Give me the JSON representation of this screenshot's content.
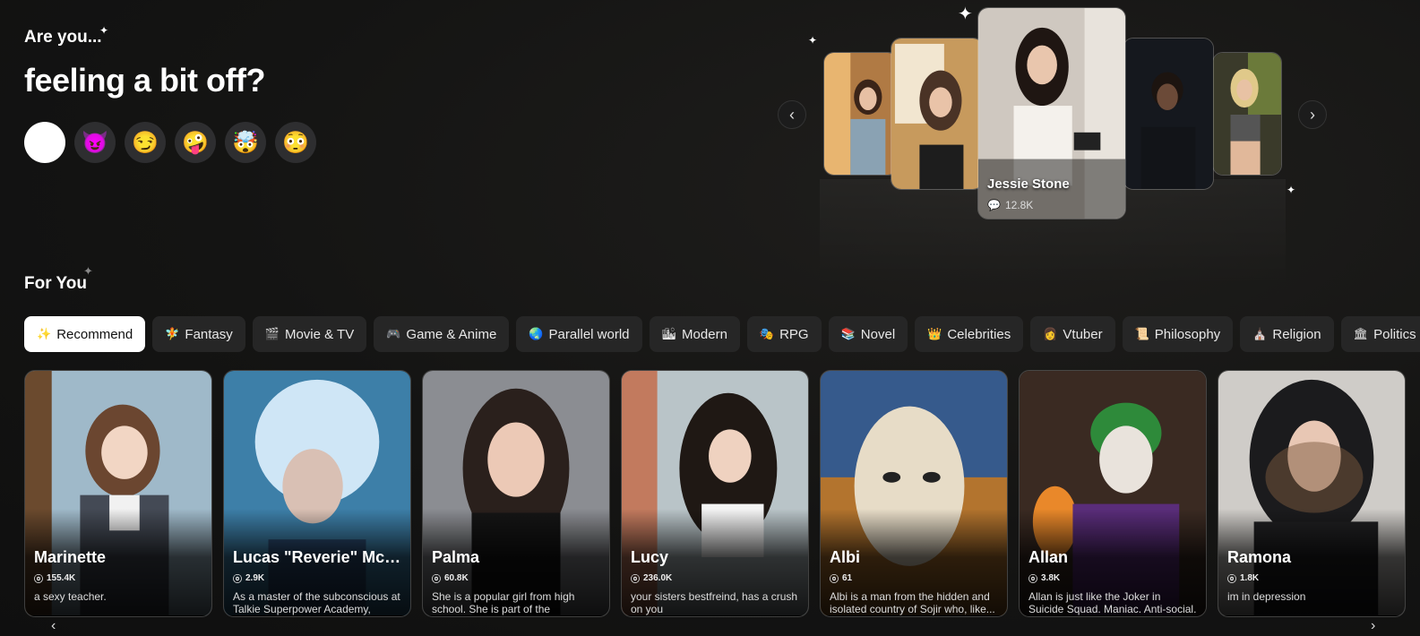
{
  "hero": {
    "kicker": "Are you...",
    "title": "feeling a bit off?",
    "moods": [
      {
        "emoji": "",
        "name": "mood-none"
      },
      {
        "emoji": "😈",
        "name": "mood-devil"
      },
      {
        "emoji": "😏",
        "name": "mood-smirk"
      },
      {
        "emoji": "🤪",
        "name": "mood-zany"
      },
      {
        "emoji": "🤯",
        "name": "mood-mind-blown"
      },
      {
        "emoji": "😳",
        "name": "mood-flushed"
      }
    ]
  },
  "featured": {
    "name": "Jessie Stone",
    "chats": "12.8K",
    "prev_icon": "chevron-left-icon",
    "next_icon": "chevron-right-icon"
  },
  "section": {
    "title": "For You"
  },
  "tabs": [
    {
      "icon": "✨",
      "label": "Recommend"
    },
    {
      "icon": "🧚",
      "label": "Fantasy"
    },
    {
      "icon": "🎬",
      "label": "Movie & TV"
    },
    {
      "icon": "🎮",
      "label": "Game & Anime"
    },
    {
      "icon": "🌏",
      "label": "Parallel world"
    },
    {
      "icon": "🏙",
      "label": "Modern"
    },
    {
      "icon": "🎭",
      "label": "RPG"
    },
    {
      "icon": "📚",
      "label": "Novel"
    },
    {
      "icon": "👑",
      "label": "Celebrities"
    },
    {
      "icon": "👩",
      "label": "Vtuber"
    },
    {
      "icon": "📜",
      "label": "Philosophy"
    },
    {
      "icon": "⛪",
      "label": "Religion"
    },
    {
      "icon": "🏛",
      "label": "Politics"
    }
  ],
  "cards": [
    {
      "name": "Marinette",
      "stat": "155.4K",
      "desc": "a sexy teacher."
    },
    {
      "name": "Lucas \"Reverie\" McC...",
      "stat": "2.9K",
      "desc": "As a master of the subconscious at Talkie Superpower Academy, Luca..."
    },
    {
      "name": "Palma",
      "stat": "60.8K",
      "desc": "She is a popular girl from high school. She is part of the volleybal..."
    },
    {
      "name": "Lucy",
      "stat": "236.0K",
      "desc": "your sisters bestfreind, has a crush on you"
    },
    {
      "name": "Albi",
      "stat": "61",
      "desc": "Albi is a man from the hidden and isolated country of Sojir who, like..."
    },
    {
      "name": "Allan",
      "stat": "3.8K",
      "desc": "Allan is just like the Joker in Suicide Squad. Maniac. Anti-social. A real..."
    },
    {
      "name": "Ramona",
      "stat": "1.8K",
      "desc": "im in depression"
    }
  ],
  "colors": {
    "background": "#141413",
    "tab_bg": "#262626",
    "active_tab_bg": "#ffffff"
  }
}
